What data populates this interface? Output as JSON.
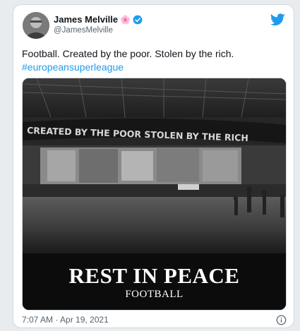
{
  "author": {
    "name": "James Melville",
    "emoji": "🌸",
    "handle": "@JamesMelville",
    "verified": true
  },
  "tweet": {
    "text": "Football. Created by the poor. Stolen by the rich.",
    "hashtag": "#europeansuperleague"
  },
  "media": {
    "banner_text": "CREATED BY THE POOR STOLEN BY THE RICH",
    "headline": "REST IN PEACE",
    "subline": "FOOTBALL"
  },
  "footer": {
    "timestamp": "7:07 AM · Apr 19, 2021"
  },
  "colors": {
    "link": "#1d9bf0",
    "verified": "#1d9bf0",
    "twitter_brand": "#1d9bf0",
    "text": "#0f1419",
    "muted": "#536471"
  },
  "icons": [
    "twitter-logo-icon",
    "verified-badge-icon",
    "info-icon"
  ]
}
